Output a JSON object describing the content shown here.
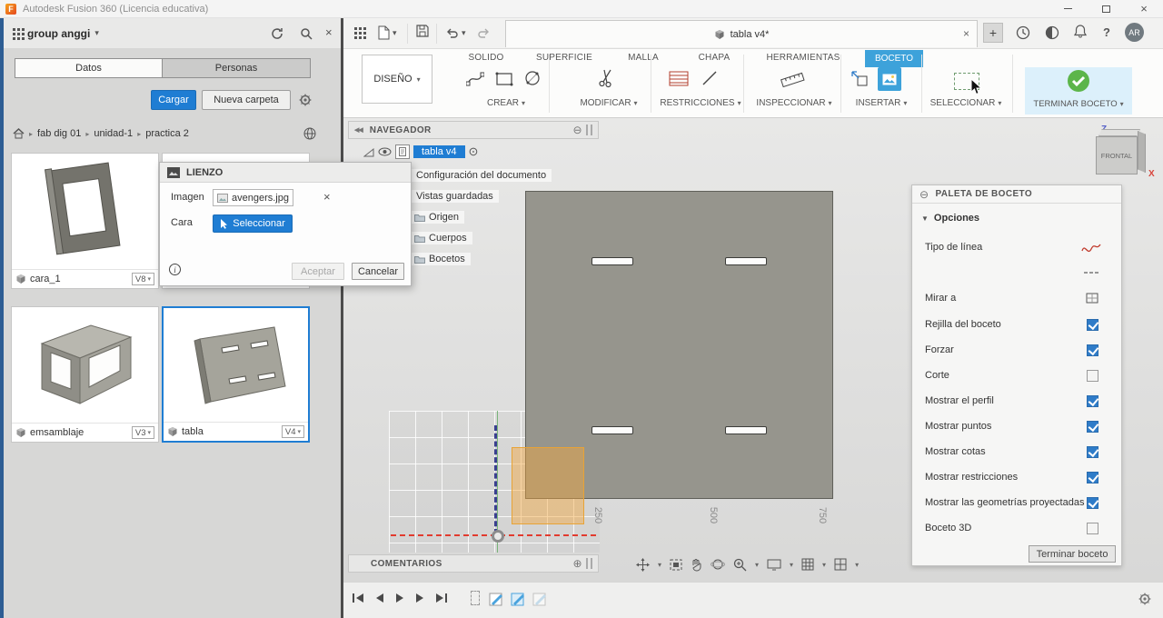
{
  "colors": {
    "accent_blue": "#1f7dd3",
    "active_tab_blue": "#3da2da",
    "finish_green": "#5cb54a",
    "selection_orange": "#f0a43c",
    "part_gray": "#96958d"
  },
  "icons": {
    "logo": "F",
    "caret_down": "▾",
    "crumb_sep": "▸",
    "tri_right": "▸",
    "section_down": "▼",
    "collapse": "⊖",
    "expand": "⊕",
    "target": "⊙",
    "close": "×",
    "plus": "+",
    "help": "?",
    "info": "i",
    "collapse_double": "◀◀"
  },
  "titlebar": {
    "title": "Autodesk Fusion 360 (Licencia educativa)"
  },
  "data_panel": {
    "project_name": "group anggi",
    "tabs": {
      "datos": "Datos",
      "personas": "Personas"
    },
    "upload_button": "Cargar",
    "new_folder_button": "Nueva carpeta",
    "breadcrumb": {
      "root": "fab dig 01",
      "folder": "unidad-1",
      "subfolder": "practica 2"
    },
    "items": [
      {
        "name": "cara_1",
        "version": "V8"
      },
      {
        "name": "",
        "version": ""
      },
      {
        "name": "emsamblaje",
        "version": "V3"
      },
      {
        "name": "tabla",
        "version": "V4"
      }
    ]
  },
  "dialog": {
    "title": "LIENZO",
    "image_label": "Imagen",
    "image_file": "avengers.jpg",
    "face_label": "Cara",
    "select_button": "Seleccionar",
    "ok_button": "Aceptar",
    "cancel_button": "Cancelar"
  },
  "toolbar": {
    "document_tab": "tabla v4*",
    "avatar_initials": "AR"
  },
  "ribbon": {
    "design_menu": "DISEÑO",
    "tabs": [
      {
        "label": "SOLIDO"
      },
      {
        "label": "SUPERFICIE"
      },
      {
        "label": "MALLA"
      },
      {
        "label": "CHAPA"
      },
      {
        "label": "HERRAMIENTAS"
      },
      {
        "label": "BOCETO"
      }
    ],
    "active_tab": "BOCETO",
    "groups": [
      "CREAR",
      "MODIFICAR",
      "RESTRICCIONES",
      "INSPECCIONAR",
      "INSERTAR",
      "SELECCIONAR"
    ],
    "finish_button": "TERMINAR BOCETO"
  },
  "navigator": {
    "title": "NAVEGADOR",
    "document_name": "tabla v4",
    "rows": [
      "Configuración del documento",
      "Vistas guardadas",
      "Origen",
      "Cuerpos",
      "Bocetos"
    ]
  },
  "viewcube": {
    "face": "FRONTAL",
    "axis_z": "Z",
    "axis_x": "X"
  },
  "canvas": {
    "ruler_labels": [
      "250",
      "500",
      "750"
    ]
  },
  "sketch_palette": {
    "title": "PALETA DE BOCETO",
    "section_title": "Opciones",
    "rows": [
      {
        "label": "Tipo de línea"
      },
      {
        "label": ""
      },
      {
        "label": "Mirar a"
      },
      {
        "label": "Rejilla del boceto",
        "checked": true
      },
      {
        "label": "Forzar",
        "checked": true
      },
      {
        "label": "Corte",
        "checked": false
      },
      {
        "label": "Mostrar el perfil",
        "checked": true
      },
      {
        "label": "Mostrar puntos",
        "checked": true
      },
      {
        "label": "Mostrar cotas",
        "checked": true
      },
      {
        "label": "Mostrar restricciones",
        "checked": true
      },
      {
        "label": "Mostrar las geometrías proyectadas",
        "checked": true
      },
      {
        "label": "Boceto 3D",
        "checked": false
      }
    ],
    "finish_button": "Terminar boceto"
  },
  "comments": {
    "title": "COMENTARIOS"
  }
}
